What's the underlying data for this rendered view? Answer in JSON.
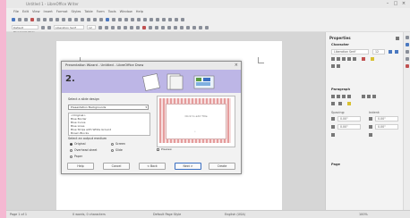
{
  "window": {
    "title": "Untitled 1 - LibreOffice Writer",
    "min_label": "–",
    "max_label": "□",
    "close_label": "×"
  },
  "menu": [
    "File",
    "Edit",
    "View",
    "Insert",
    "Format",
    "Styles",
    "Table",
    "Form",
    "Tools",
    "Window",
    "Help"
  ],
  "toolbar": {
    "style_combo": "Default Paragraph Style",
    "font_combo": "Liberation Serif",
    "size_combo": "12"
  },
  "sidebar": {
    "title": "Properties",
    "character_header": "Character",
    "font_name": "Liberation Serif",
    "font_size": "12",
    "paragraph_header": "Paragraph",
    "spacing_label": "Spacing:",
    "indent_label": "Indent:",
    "spacing_above": "0.00\"",
    "spacing_below": "0.00\"",
    "indent_before": "0.00\"",
    "indent_after": "0.00\"",
    "page_header": "Page"
  },
  "status": {
    "page": "Page 1 of 1",
    "words": "0 words, 0 characters",
    "style": "Default Page Style",
    "language": "English (USA)",
    "zoom": "100%"
  },
  "dialog": {
    "title": "Presentation Wizard - Untitled - LibreOffice Draw",
    "close_label": "×",
    "step_number": "2.",
    "section_select": "Select a slide design",
    "combo_value": "Presentation Backgrounds",
    "list_items": [
      "<Original>",
      "Blue Border",
      "Blue Curve",
      "Blue Lines",
      "Blue Strips with White Ground",
      "Brown Blocks"
    ],
    "section_output": "Select an output medium",
    "radio_original": "Original",
    "radio_screen": "Screen",
    "radio_overhead": "Overhead sheet",
    "radio_slide": "Slide",
    "radio_paper": "Paper",
    "preview_text": "Click to add Title",
    "preview_text2": "•",
    "preview_checkbox": "Preview",
    "btn_help": "Help",
    "btn_cancel": "Cancel",
    "btn_back": "< Back",
    "btn_next": "Next >",
    "btn_create": "Create"
  },
  "colors": {
    "banner": "#bdb6e6",
    "preview_border": "#e59c9c",
    "accent": "#3b6fc1",
    "background": "#f5b8d2"
  }
}
